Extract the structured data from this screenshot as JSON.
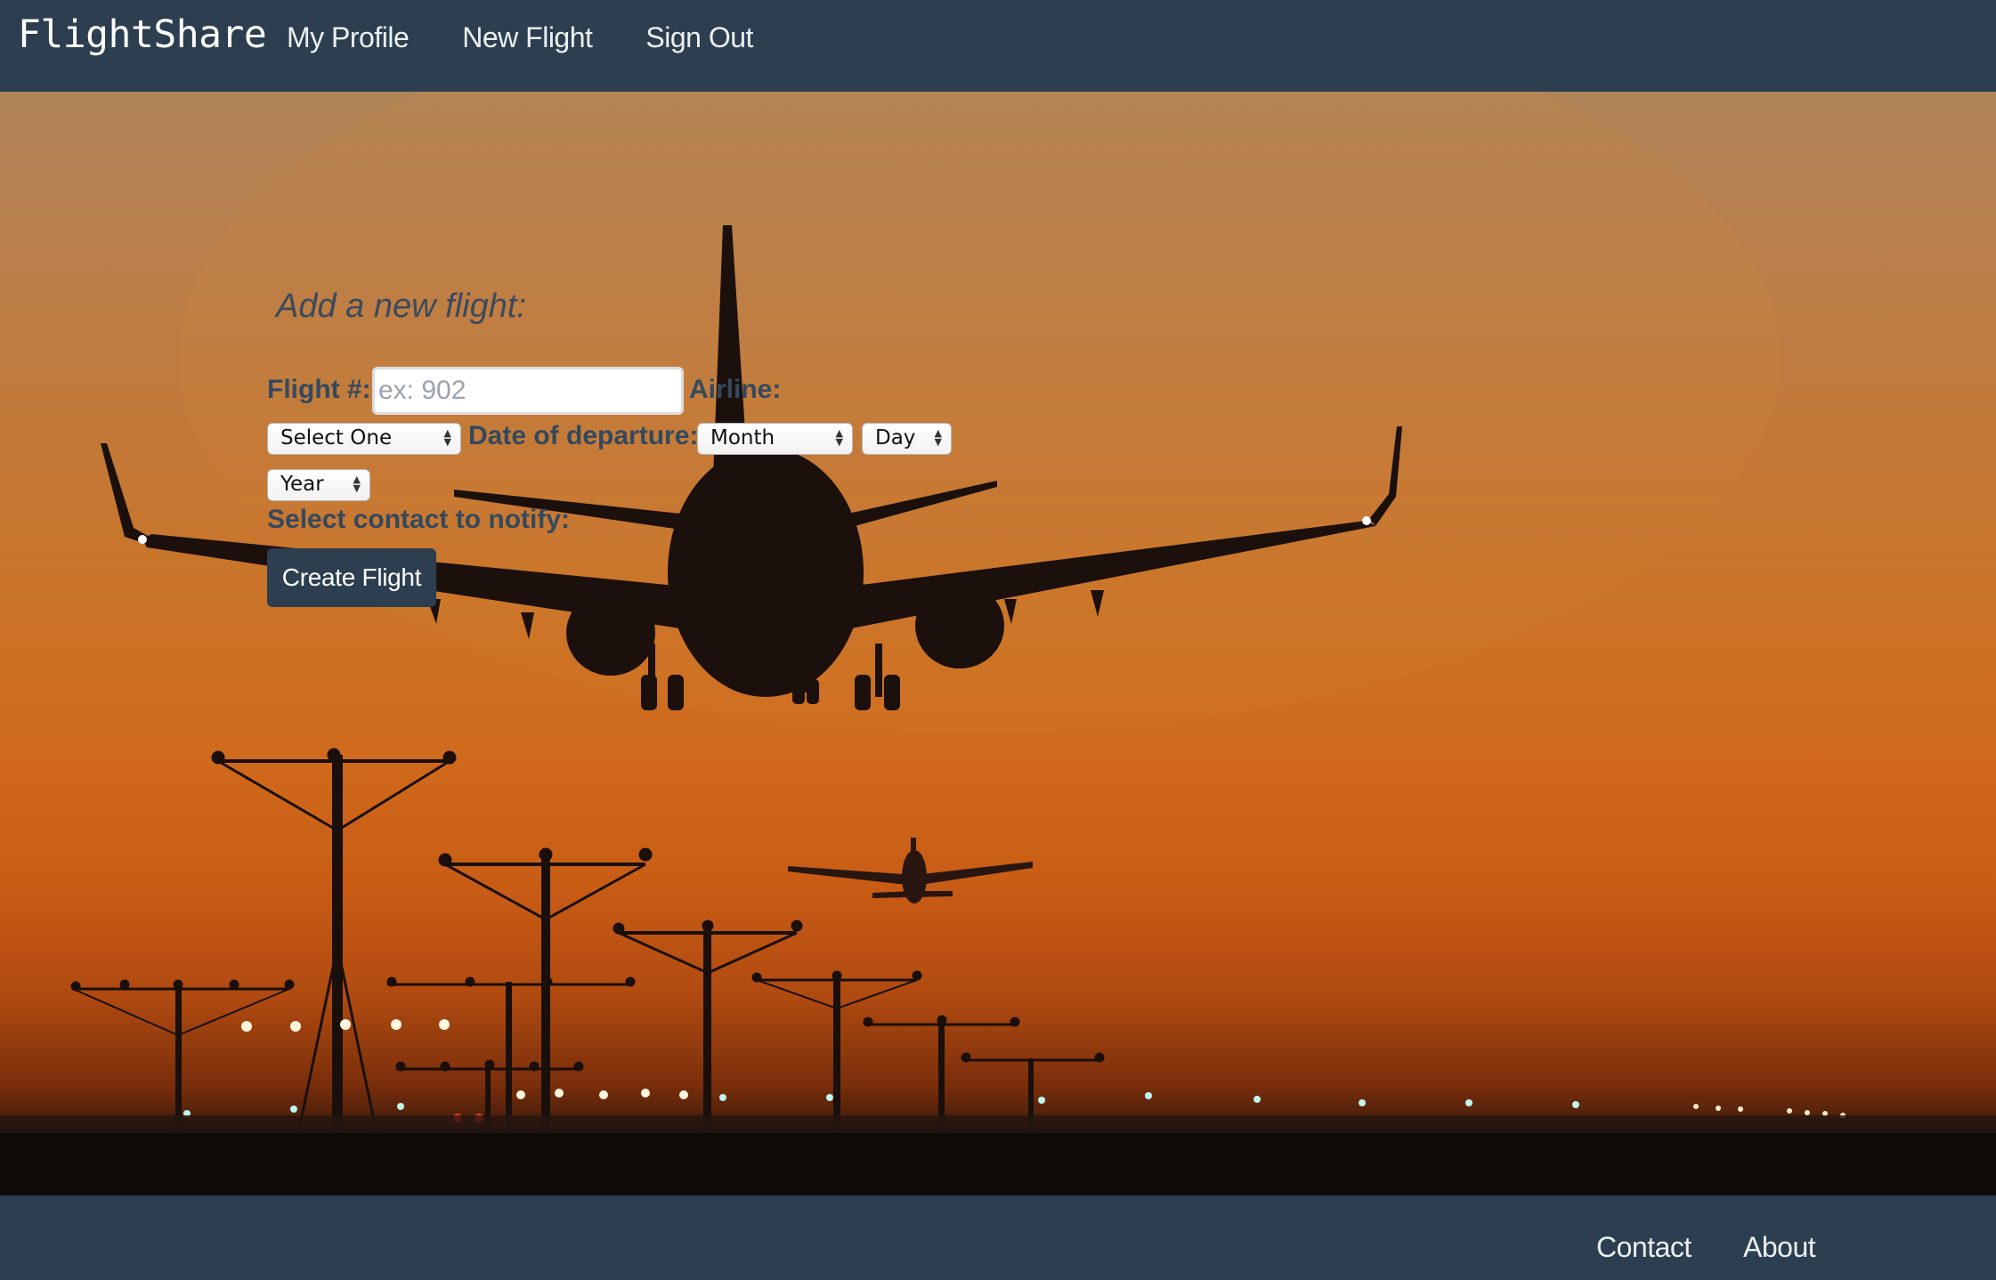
{
  "navbar": {
    "brand": "FlightShare",
    "links": [
      "My Profile",
      "New Flight",
      "Sign Out"
    ]
  },
  "form": {
    "title": "Add a new flight:",
    "flight_number_label": "Flight #:",
    "flight_number_placeholder": "ex: 902",
    "flight_number_value": "",
    "airline_label": "Airline:",
    "airline_selected": "Select One",
    "date_label": "Date of departure:",
    "month_selected": "Month",
    "day_selected": "Day",
    "year_selected": "Year",
    "contact_label": "Select contact to notify:",
    "submit_label": "Create Flight"
  },
  "footer": {
    "links": [
      "Contact",
      "About"
    ]
  },
  "colors": {
    "nav_background": "#2c3e50",
    "label_text": "#34495e",
    "button_background": "#2c3e50",
    "sky_top": "#b08458",
    "sky_bottom": "#c95c15"
  },
  "icons": [
    "select-arrows-icon"
  ],
  "hero_image": "sunset airport runway with landing airplanes silhouette"
}
